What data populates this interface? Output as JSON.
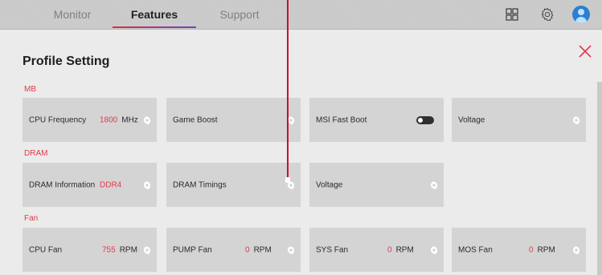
{
  "nav": {
    "tabs": [
      {
        "label": "Monitor",
        "active": false
      },
      {
        "label": "Features",
        "active": true
      },
      {
        "label": "Support",
        "active": false
      }
    ],
    "icons": [
      "grid-icon",
      "gear-icon",
      "user-avatar"
    ]
  },
  "panel": {
    "title": "Profile Setting",
    "close_icon": "close-icon",
    "sections": [
      {
        "label": "MB",
        "cards": [
          {
            "name": "CPU Frequency",
            "value": "1800",
            "unit": "MHz",
            "control": "gear"
          },
          {
            "name": "Game Boost",
            "control": "gear"
          },
          {
            "name": "MSI Fast Boot",
            "control": "toggle",
            "state": "off"
          },
          {
            "name": "Voltage",
            "control": "gear"
          }
        ]
      },
      {
        "label": "DRAM",
        "cards": [
          {
            "name": "DRAM Information",
            "value": "DDR4",
            "control": "gear"
          },
          {
            "name": "DRAM Timings",
            "control": "gear"
          },
          {
            "name": "Voltage",
            "control": "gear"
          }
        ]
      },
      {
        "label": "Fan",
        "cards": [
          {
            "name": "CPU Fan",
            "value": "755",
            "unit": "RPM",
            "control": "gear"
          },
          {
            "name": "PUMP Fan",
            "value": "0",
            "unit": "RPM",
            "control": "gear"
          },
          {
            "name": "SYS Fan",
            "value": "0",
            "unit": "RPM",
            "control": "gear"
          },
          {
            "name": "MOS Fan",
            "value": "0",
            "unit": "RPM",
            "control": "gear"
          }
        ]
      }
    ]
  },
  "colors": {
    "accent_red": "#e0394f",
    "card_bg": "#d4d4d4",
    "panel_bg": "#ebebeb",
    "tab_underline_start": "#e02a45",
    "tab_underline_end": "#6e44c4"
  }
}
